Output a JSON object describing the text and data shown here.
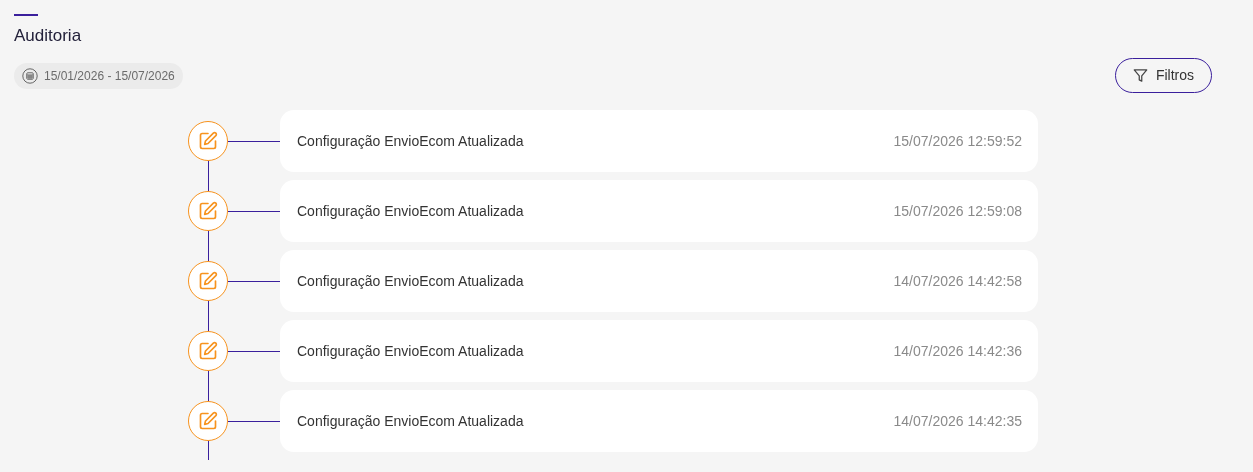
{
  "page": {
    "title": "Auditoria"
  },
  "date_range": "15/01/2026 - 15/07/2026",
  "filter_button": "Filtros",
  "timeline": [
    {
      "kind": "edit",
      "title": "Configuração EnvioEcom Atualizada",
      "timestamp": "15/07/2026 12:59:52"
    },
    {
      "kind": "edit",
      "title": "Configuração EnvioEcom Atualizada",
      "timestamp": "15/07/2026 12:59:08"
    },
    {
      "kind": "edit",
      "title": "Configuração EnvioEcom Atualizada",
      "timestamp": "14/07/2026 14:42:58"
    },
    {
      "kind": "edit",
      "title": "Configuração EnvioEcom Atualizada",
      "timestamp": "14/07/2026 14:42:36"
    },
    {
      "kind": "edit",
      "title": "Configuração EnvioEcom Atualizada",
      "timestamp": "14/07/2026 14:42:35"
    }
  ]
}
